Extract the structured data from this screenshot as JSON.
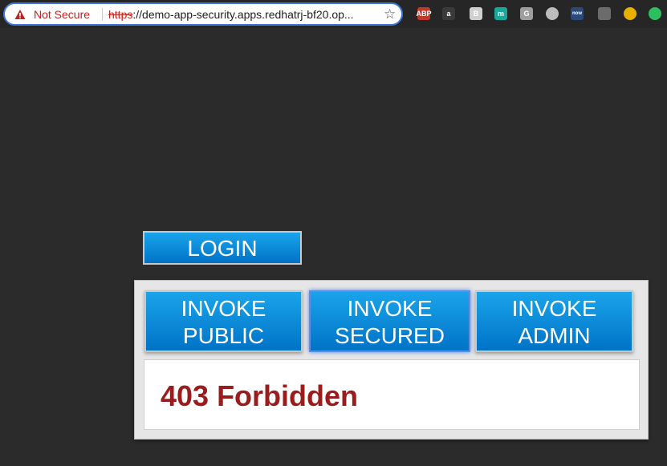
{
  "browser": {
    "security_label": "Not Secure",
    "url_scheme": "https",
    "url_rest": "://demo-app-security.apps.redhatrj-bf20.op...",
    "extensions": [
      {
        "name": "adblock-icon",
        "label": "ABP",
        "color": "#c0392b"
      },
      {
        "name": "extension-a-icon",
        "label": "a",
        "color": "#3a3a3a"
      },
      {
        "name": "extension-b-icon",
        "label": "B",
        "color": "#d0d0d0"
      },
      {
        "name": "extension-m-icon",
        "label": "m",
        "color": "#1aa89c"
      },
      {
        "name": "extension-g-icon",
        "label": "G",
        "color": "#9e9e9e"
      },
      {
        "name": "extension-circle-icon",
        "label": "",
        "color": "#bdbdbd"
      },
      {
        "name": "extension-now-icon",
        "label": "now",
        "color": "#2a4a7a"
      },
      {
        "name": "extension-bulb-icon",
        "label": "",
        "color": "#6b6b6b"
      },
      {
        "name": "extension-chrome-icon",
        "label": "",
        "color": "#e8b100"
      },
      {
        "name": "extension-evernote-icon",
        "label": "",
        "color": "#2dbe60"
      }
    ]
  },
  "app": {
    "login_label": "LOGIN",
    "invoke_public_line1": "INVOKE",
    "invoke_public_line2": "PUBLIC",
    "invoke_secured_line1": "INVOKE",
    "invoke_secured_line2": "SECURED",
    "invoke_admin_line1": "INVOKE",
    "invoke_admin_line2": "ADMIN",
    "result_text": "403 Forbidden"
  },
  "colors": {
    "button_top": "#1aa4ea",
    "button_bottom": "#0073c7",
    "error_text": "#9b1c1c"
  }
}
